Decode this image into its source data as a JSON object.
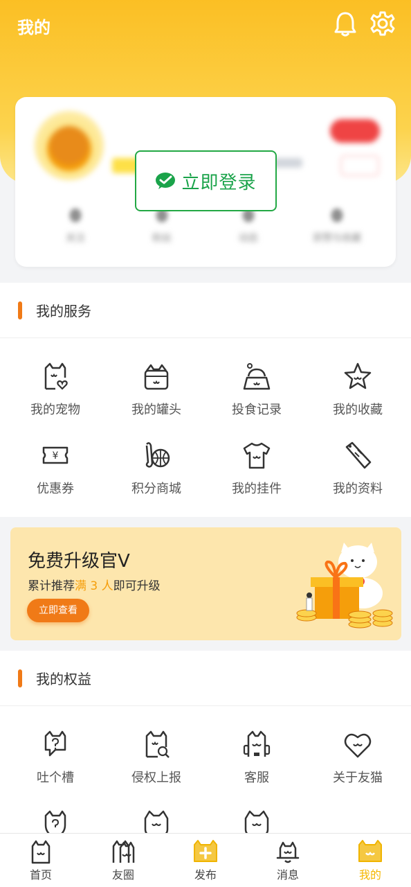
{
  "header": {
    "title": "我的"
  },
  "profile": {
    "stats": [
      {
        "value": "0",
        "label": "关注"
      },
      {
        "value": "0",
        "label": "粉丝"
      },
      {
        "value": "0",
        "label": "动态"
      },
      {
        "value": "0",
        "label": "获赞与收藏"
      }
    ],
    "login_label": "立即登录"
  },
  "services": {
    "title": "我的服务",
    "items": [
      {
        "label": "我的宠物",
        "icon": "cat-heart-icon"
      },
      {
        "label": "我的罐头",
        "icon": "can-icon"
      },
      {
        "label": "投食记录",
        "icon": "feed-bowl-icon"
      },
      {
        "label": "我的收藏",
        "icon": "star-icon"
      },
      {
        "label": "优惠券",
        "icon": "coupon-icon"
      },
      {
        "label": "积分商城",
        "icon": "points-ball-icon"
      },
      {
        "label": "我的挂件",
        "icon": "tshirt-icon"
      },
      {
        "label": "我的资料",
        "icon": "profile-tag-icon"
      }
    ]
  },
  "promo": {
    "title": "免费升级官V",
    "sub_prefix": "累计推荐",
    "sub_highlight": "满 3 人",
    "sub_suffix": "即可升级",
    "button": "立即查看"
  },
  "rights": {
    "title": "我的权益",
    "items": [
      {
        "label": "吐个槽",
        "icon": "feedback-cat-icon"
      },
      {
        "label": "侵权上报",
        "icon": "report-cat-icon"
      },
      {
        "label": "客服",
        "icon": "service-cat-icon"
      },
      {
        "label": "关于友猫",
        "icon": "heart-cat-icon"
      }
    ]
  },
  "bottom_nav": [
    {
      "label": "首页",
      "icon": "home-cat-icon"
    },
    {
      "label": "友圈",
      "icon": "friends-cat-icon"
    },
    {
      "label": "发布",
      "icon": "publish-icon"
    },
    {
      "label": "消息",
      "icon": "message-bell-icon"
    },
    {
      "label": "我的",
      "icon": "me-cat-icon",
      "active": true
    }
  ],
  "colors": {
    "accent": "#f07a17",
    "header": "#fbbf24",
    "login_green": "#1aa34a",
    "active_tab": "#f5b700"
  }
}
